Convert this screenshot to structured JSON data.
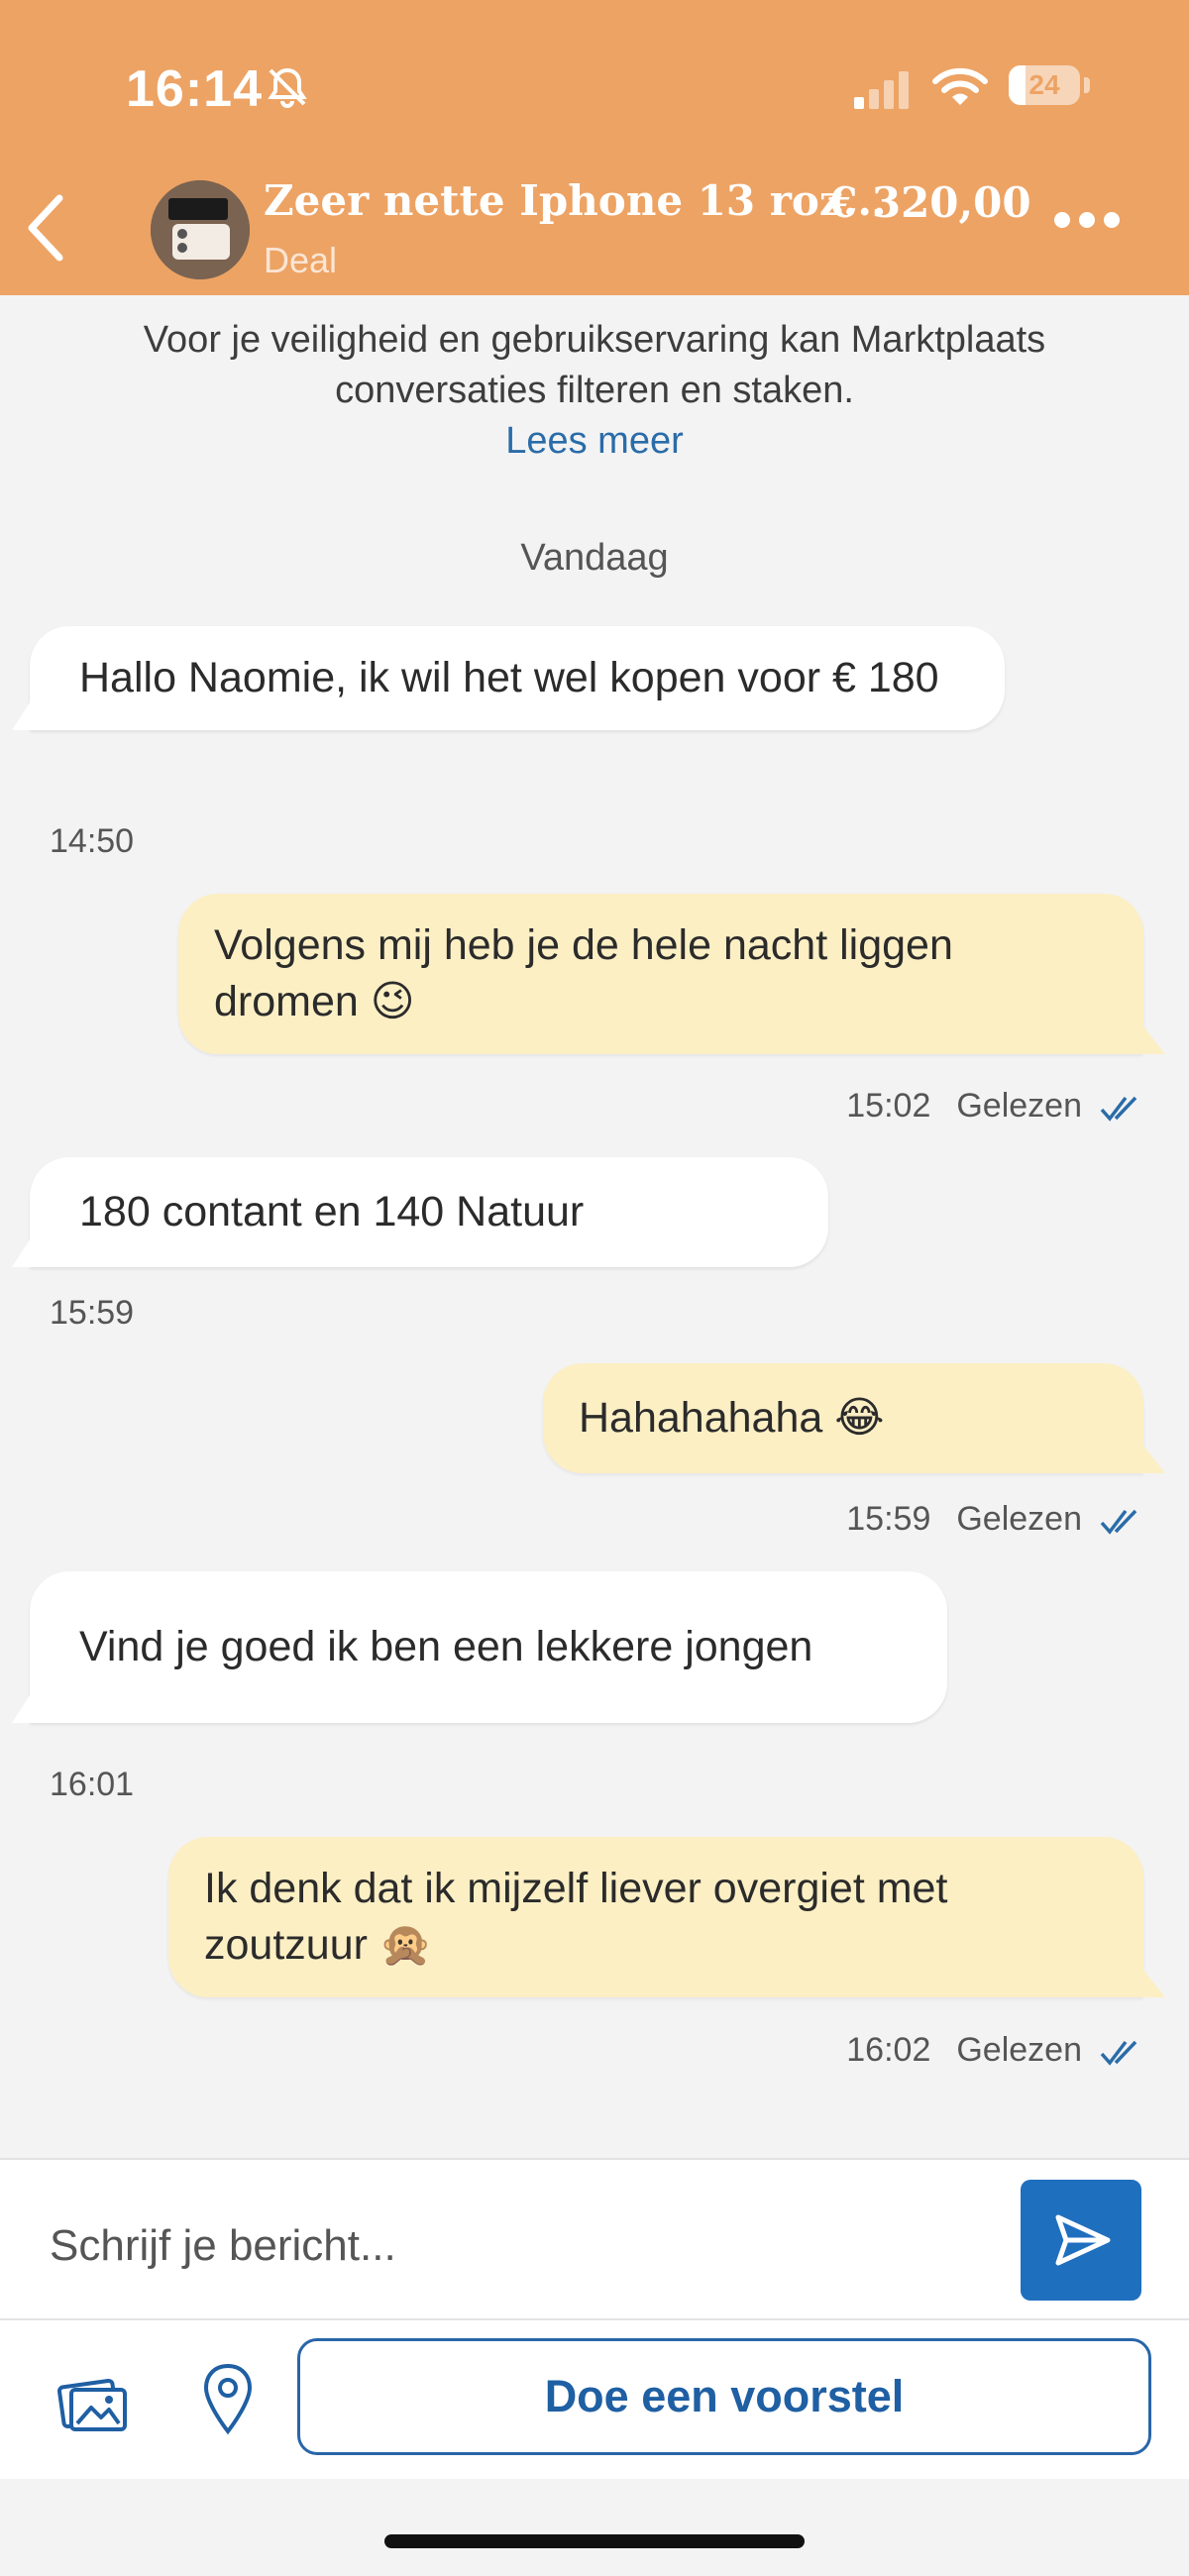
{
  "status_bar": {
    "time": "16:14",
    "battery": "24",
    "battery_level_percent": 24,
    "icons": [
      "bell-off-icon",
      "signal-icon",
      "wifi-icon",
      "battery-icon"
    ]
  },
  "header": {
    "listing_title": "Zeer nette Iphone 13 roz...",
    "price": "€ 320,00",
    "status": "Deal",
    "back_icon": "chevron-left-icon",
    "more_icon": "more-dots-icon",
    "background_color": "#eda364"
  },
  "notice": {
    "text": "Voor je veiligheid en gebruikservaring kan Marktplaats conversaties filteren en staken.",
    "link": "Lees meer"
  },
  "date_separator": "Vandaag",
  "messages": [
    {
      "direction": "incoming",
      "text": "Hallo Naomie, ik wil het wel kopen voor € 180",
      "time": "14:50"
    },
    {
      "direction": "outgoing",
      "text": "Volgens mij heb je de hele nacht liggen dromen 😉",
      "time": "15:02",
      "status": "Gelezen"
    },
    {
      "direction": "incoming",
      "text": "180 contant en 140 Natuur",
      "time": "15:59"
    },
    {
      "direction": "outgoing",
      "text": "Hahahahaha 😂",
      "time": "15:59",
      "status": "Gelezen"
    },
    {
      "direction": "incoming",
      "text": "Vind je goed ik ben een lekkere jongen",
      "time": "16:01"
    },
    {
      "direction": "outgoing",
      "text": "Ik denk dat ik mijzelf liever overgiet met zoutzuur 🙊",
      "time": "16:02",
      "status": "Gelezen"
    }
  ],
  "composer": {
    "placeholder": "Schrijf je bericht...",
    "value": "",
    "send_icon": "send-icon",
    "photo_icon": "photo-icon",
    "location_icon": "location-pin-icon",
    "offer_button": "Doe een voorstel"
  },
  "colors": {
    "accent_blue": "#1f6fbf",
    "outgoing_bubble": "#fcefc4",
    "incoming_bubble": "#ffffff"
  }
}
